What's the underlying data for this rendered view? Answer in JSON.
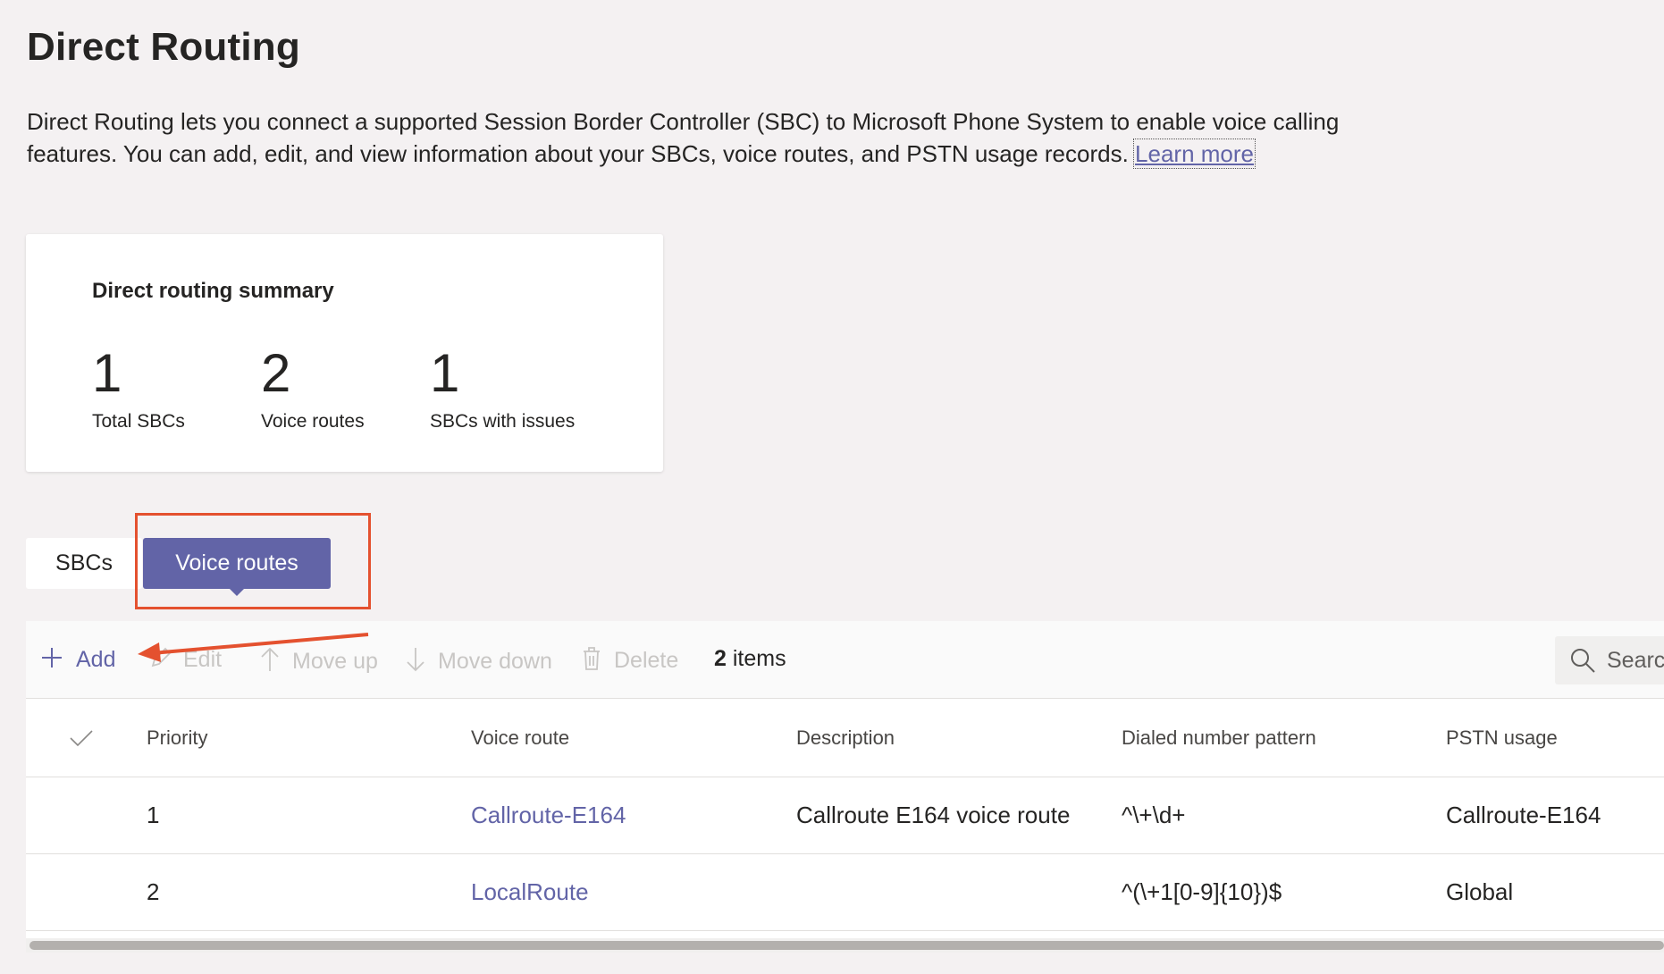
{
  "page": {
    "title": "Direct Routing",
    "intro_text": "Direct Routing lets you connect a supported Session Border Controller (SBC) to Microsoft Phone System to enable voice calling features. You can add, edit, and view information about your SBCs, voice routes, and PSTN usage records. ",
    "learn_more": "Learn more"
  },
  "summary": {
    "title": "Direct routing summary",
    "stats": [
      {
        "value": "1",
        "label": "Total SBCs"
      },
      {
        "value": "2",
        "label": "Voice routes"
      },
      {
        "value": "1",
        "label": "SBCs with issues"
      }
    ]
  },
  "tabs": [
    {
      "label": "SBCs",
      "selected": false
    },
    {
      "label": "Voice routes",
      "selected": true
    }
  ],
  "toolbar": {
    "add": "Add",
    "edit": "Edit",
    "move_up": "Move up",
    "move_down": "Move down",
    "delete": "Delete",
    "item_count": "2",
    "item_count_suffix": " items",
    "search_placeholder": "Search"
  },
  "table": {
    "columns": [
      "Priority",
      "Voice route",
      "Description",
      "Dialed number pattern",
      "PSTN usage"
    ],
    "rows": [
      {
        "priority": "1",
        "voice_route": "Callroute-E164",
        "description": "Callroute E164 voice route",
        "pattern": "^\\+\\d+",
        "pstn_usage": "Callroute-E164"
      },
      {
        "priority": "2",
        "voice_route": "LocalRoute",
        "description": "",
        "pattern": "^(\\+1[0-9]{10})$",
        "pstn_usage": "Global"
      }
    ]
  },
  "colors": {
    "accent": "#6264a7",
    "annotation": "#e4512f",
    "background": "#f4f1f2"
  }
}
